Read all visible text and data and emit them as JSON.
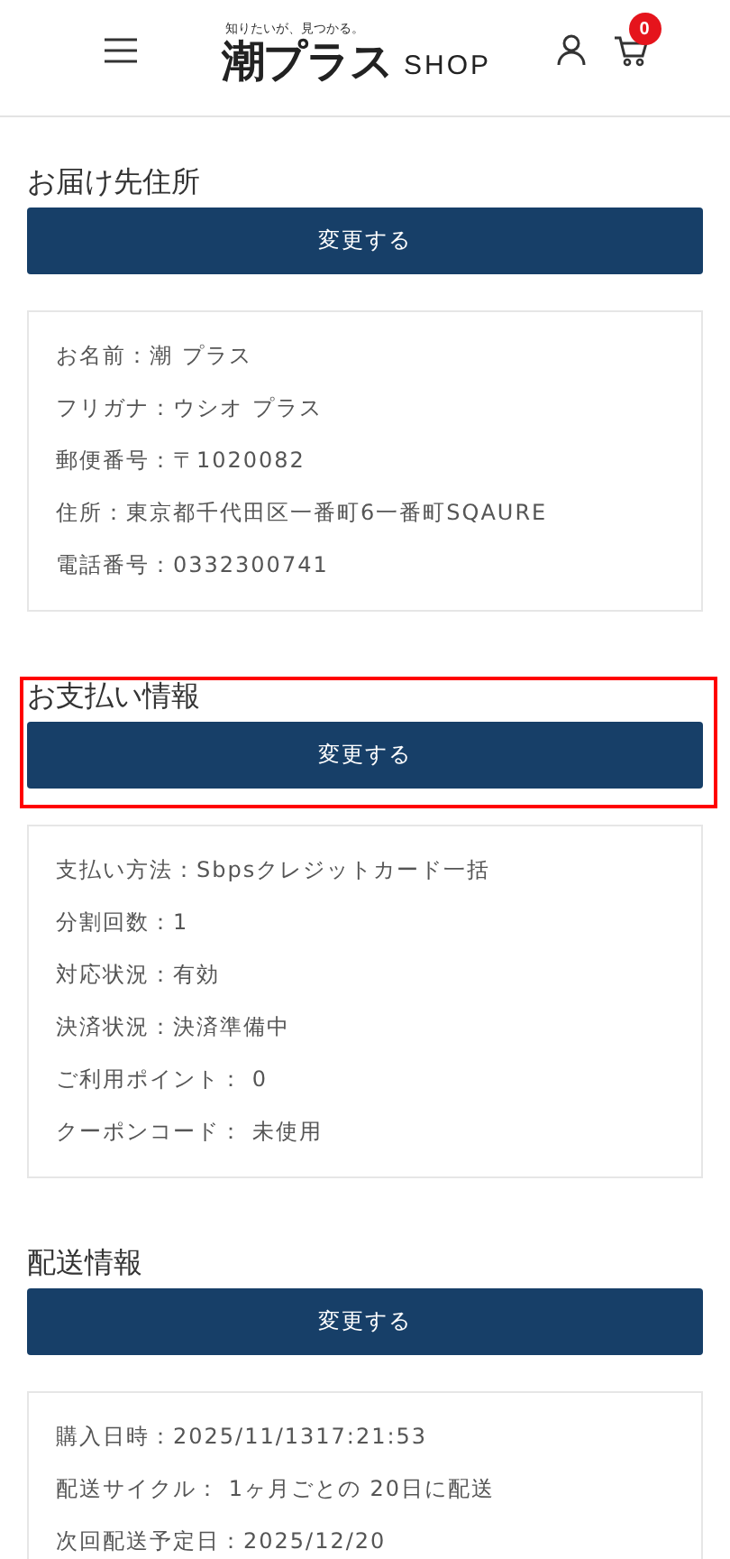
{
  "header": {
    "tagline": "知りたいが、見つかる。",
    "logo": "潮プラス",
    "logo_suffix": "SHOP",
    "cart_count": "0"
  },
  "sections": [
    {
      "title": "お届け先住所",
      "button": "変更する",
      "highlighted": false,
      "rows": [
        "お名前：潮 プラス",
        "フリガナ：ウシオ プラス",
        "郵便番号：〒1020082",
        "住所：東京都千代田区一番町6一番町SQAURE",
        "電話番号：0332300741"
      ]
    },
    {
      "title": "お支払い情報",
      "button": "変更する",
      "highlighted": true,
      "rows": [
        "支払い方法：Sbpsクレジットカード一括",
        "分割回数：1",
        "対応状況：有効",
        "決済状況：決済準備中",
        "ご利用ポイント： 0",
        "クーポンコード： 未使用"
      ]
    },
    {
      "title": "配送情報",
      "button": "変更する",
      "highlighted": false,
      "rows": [
        "購入日時：2025/11/1317:21:53",
        "配送サイクル： 1ヶ月ごとの 20日に配送",
        "次回配送予定日：2025/12/20"
      ]
    }
  ]
}
